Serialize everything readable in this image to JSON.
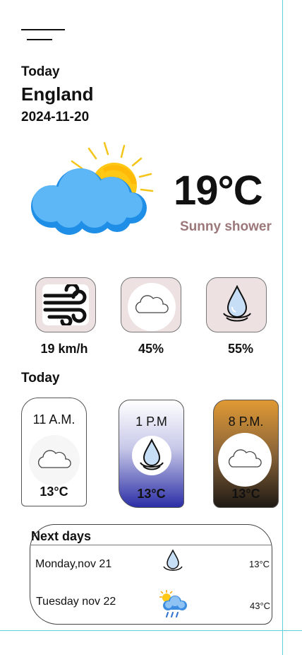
{
  "header": {
    "menu_icon": "menu-icon"
  },
  "current": {
    "label": "Today",
    "location": "England",
    "date": "2024-11-20",
    "temperature": "19°C",
    "condition": "Sunny shower",
    "icon": "sun-behind-cloud-icon"
  },
  "stats": [
    {
      "icon": "wind-icon",
      "value": "19 km/h"
    },
    {
      "icon": "cloud-icon",
      "value": "45%"
    },
    {
      "icon": "water-drop-icon",
      "value": "55%"
    }
  ],
  "hourly": {
    "title": "Today",
    "items": [
      {
        "time": "11 A.M.",
        "temp": "13°C",
        "icon": "cloud-icon"
      },
      {
        "time": "1 P.M",
        "temp": "13°C",
        "icon": "water-drop-icon"
      },
      {
        "time": "8 P.M.",
        "temp": "13°C",
        "icon": "cloud-icon"
      }
    ]
  },
  "next_days": {
    "title": "Next days",
    "items": [
      {
        "day": "Monday,nov 21",
        "temp": "13°C",
        "icon": "water-drop-icon"
      },
      {
        "day": "Tuesday nov 22",
        "temp": "43°C",
        "icon": "sun-rain-cloud-icon"
      }
    ]
  }
}
